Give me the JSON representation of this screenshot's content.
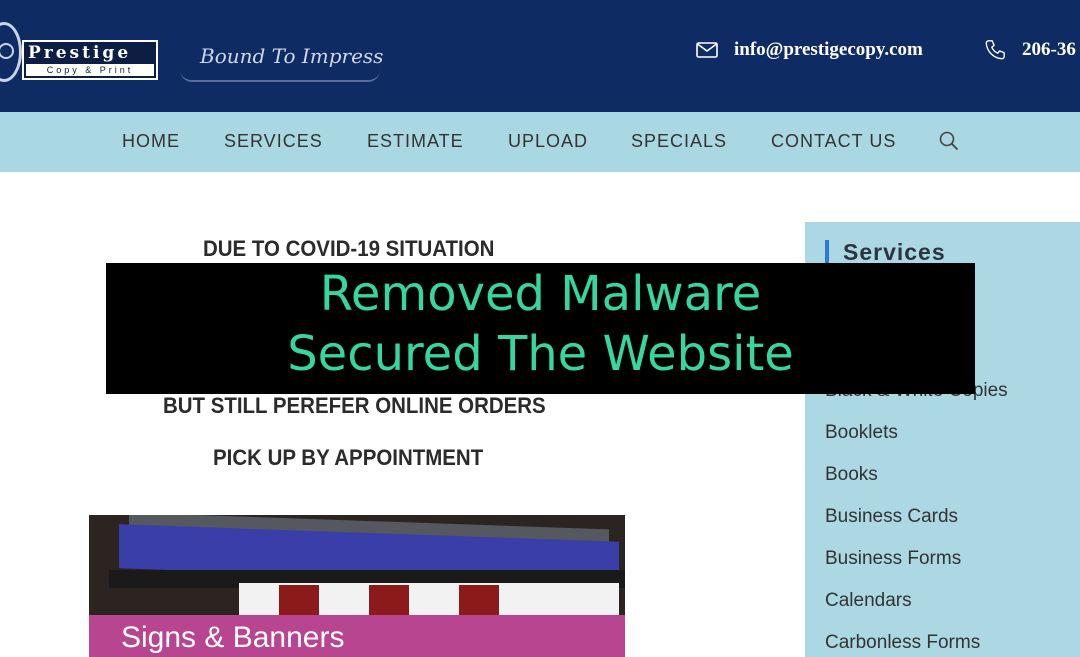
{
  "header": {
    "logo": {
      "name": "Prestige",
      "subtitle": "Copy & Print"
    },
    "tagline": "Bound To Impress",
    "email": "info@prestigecopy.com",
    "phone": "206-36"
  },
  "nav": {
    "items": [
      "HOME",
      "SERVICES",
      "ESTIMATE",
      "UPLOAD",
      "SPECIALS",
      "CONTACT US"
    ],
    "search_icon": "search-icon"
  },
  "main": {
    "notice_lines": [
      "DUE TO COVID-19 SITUATION",
      "BUT STILL PEREFER ONLINE ORDERS",
      "PICK UP BY APPOINTMENT"
    ],
    "photo_label": "Signs & Banners"
  },
  "sidebar": {
    "title": "Services",
    "items": [
      "Black & White Copies",
      "Booklets",
      "Books",
      "Business Cards",
      "Business Forms",
      "Calendars",
      "Carbonless Forms"
    ]
  },
  "overlay": {
    "line1": "Removed Malware",
    "line2": "Secured The Website"
  },
  "colors": {
    "header_bg": "#0f2b63",
    "nav_bg": "#a9d8e3",
    "sidebar_bg": "#abd8e3",
    "overlay_text": "#35d6a0",
    "sidebar_accent": "#2b7bd0"
  }
}
